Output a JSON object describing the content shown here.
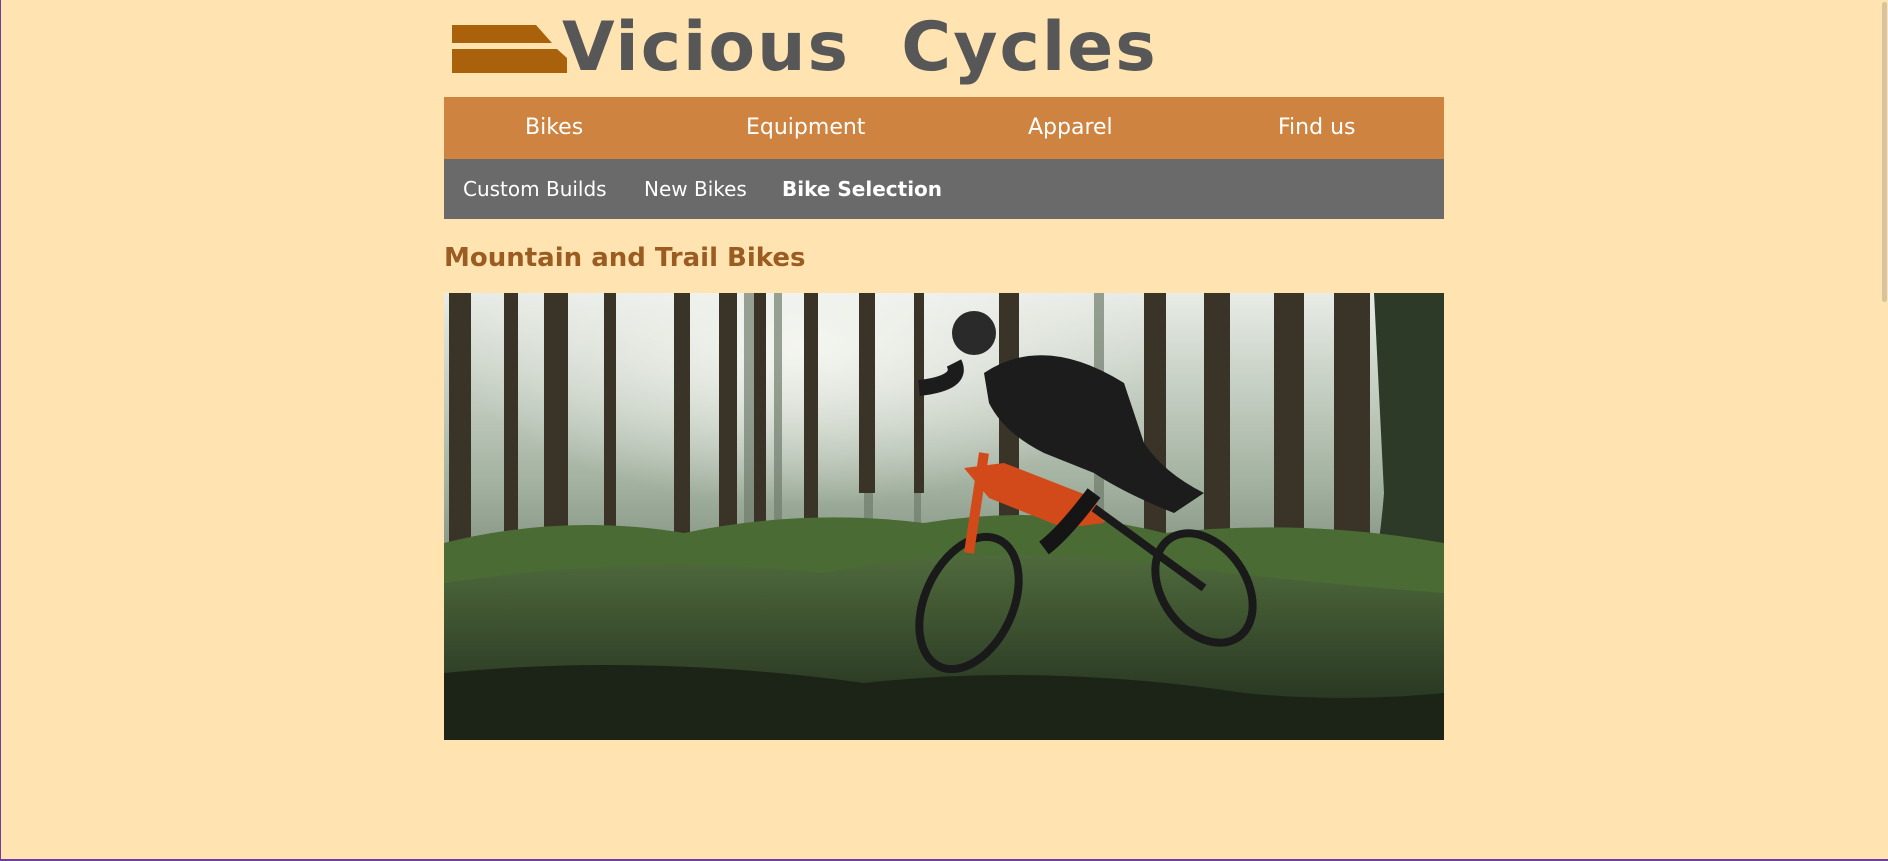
{
  "brand": {
    "name": "Vicious  Cycles",
    "colors": {
      "background": "#ffe4b2",
      "main_nav": "#ce8440",
      "sub_nav": "#6a6a6a",
      "title": "#9a5c21",
      "logo_text": "#575757",
      "logo_bars": "#a9610b"
    }
  },
  "main_nav": {
    "items": [
      {
        "label": "Bikes"
      },
      {
        "label": "Equipment"
      },
      {
        "label": "Apparel"
      },
      {
        "label": "Find us"
      }
    ]
  },
  "sub_nav": {
    "items": [
      {
        "label": "Custom Builds",
        "active": false
      },
      {
        "label": "New Bikes",
        "active": false
      },
      {
        "label": "Bike Selection",
        "active": true
      }
    ]
  },
  "main": {
    "title": "Mountain and Trail Bikes",
    "hero_image": {
      "icon": "mountain-bike-rider-forest-photo"
    }
  }
}
